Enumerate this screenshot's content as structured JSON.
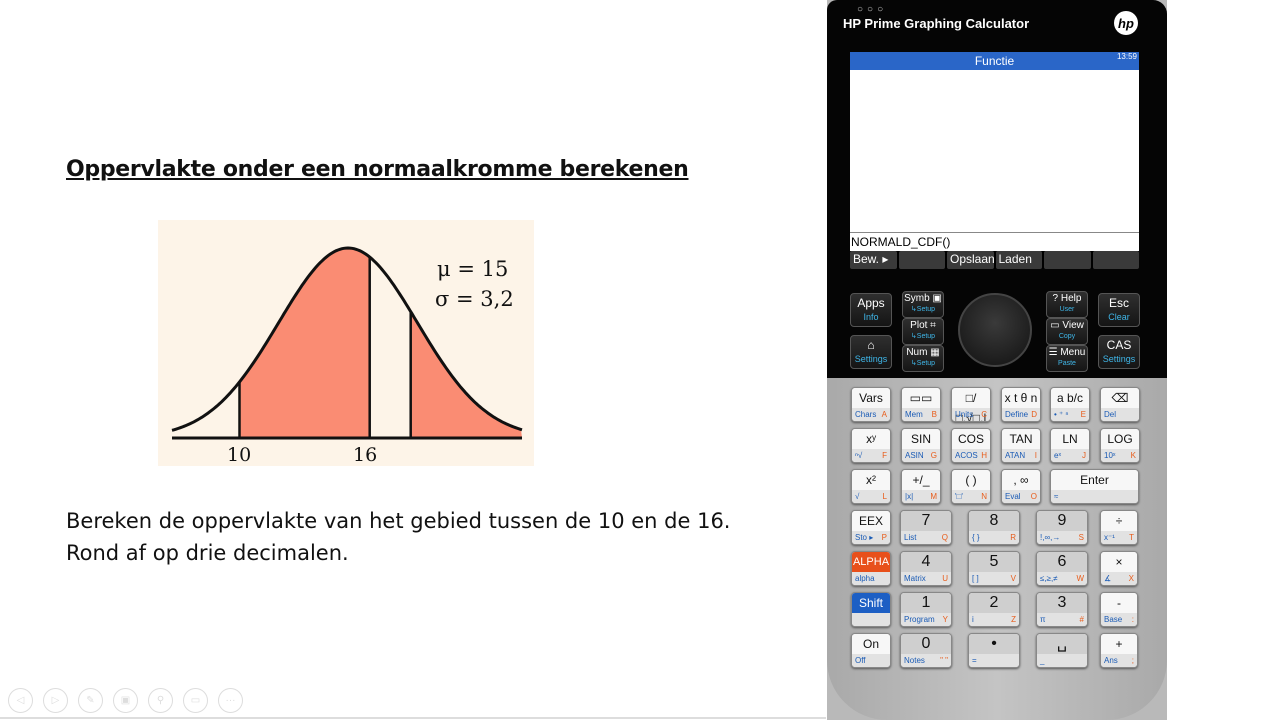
{
  "slide": {
    "title": "Oppervlakte onder een normaalkromme berekenen",
    "figure": {
      "mu_label": "μ = 15",
      "sigma_label": "σ = 3,2",
      "tick_labels": [
        "10",
        "16"
      ],
      "shade_color": "#fa8c73",
      "background": "#fdf4e8"
    },
    "question_line1": "Bereken de oppervlakte van het gebied tussen de 10 en de 16.",
    "question_line2": "Rond af op drie decimalen.",
    "toolbar_icons": [
      "back-icon",
      "forward-icon",
      "pen-icon",
      "pages-icon",
      "zoom-icon",
      "subtitles-icon",
      "more-icon"
    ]
  },
  "calculator": {
    "window_title": "HP Prime Graphing Calculator",
    "logo": "hp",
    "screen": {
      "app_title": "Functie",
      "clock": "13:59",
      "entry": "NORMALD_CDF()",
      "softkeys": [
        "Bew. ▸",
        "",
        "Opslaan",
        "Laden",
        "",
        ""
      ]
    },
    "top_keys": [
      {
        "main": "Apps",
        "shift": "Info"
      },
      {
        "main": "Symb ▣",
        "shift": "↳Setup"
      },
      {
        "main": "Plot ⌗",
        "shift": "↳Setup"
      },
      {
        "main": "Num ▦",
        "shift": "↳Setup"
      },
      {
        "main": "⌂",
        "shift": "Settings"
      },
      {
        "main": "? Help",
        "shift": "User"
      },
      {
        "main": "▭ View",
        "shift": "Copy"
      },
      {
        "main": "☰ Menu",
        "shift": "Paste"
      },
      {
        "main": "Esc",
        "shift": "Clear"
      },
      {
        "main": "CAS",
        "shift": "Settings"
      }
    ],
    "keys": [
      {
        "main": "Vars",
        "shift": "Chars",
        "alpha": "A"
      },
      {
        "main": "▭▭",
        "shift": "Mem",
        "alpha": "B"
      },
      {
        "main": "□/□,√□,|□|",
        "shift": "Units",
        "alpha": "C"
      },
      {
        "main": "x t θ n",
        "shift": "Define",
        "alpha": "D"
      },
      {
        "main": "a b/c",
        "shift": "• ⁺ ⁿ",
        "alpha": "E"
      },
      {
        "main": "⌫",
        "shift": "Del",
        "alpha": ""
      },
      {
        "main": "xʸ",
        "shift": "ⁿ√",
        "alpha": "F"
      },
      {
        "main": "SIN",
        "shift": "ASIN",
        "alpha": "G"
      },
      {
        "main": "COS",
        "shift": "ACOS",
        "alpha": "H"
      },
      {
        "main": "TAN",
        "shift": "ATAN",
        "alpha": "I"
      },
      {
        "main": "LN",
        "shift": "eˣ",
        "alpha": "J"
      },
      {
        "main": "LOG",
        "shift": "10ˣ",
        "alpha": "K"
      },
      {
        "main": "x²",
        "shift": "√",
        "alpha": "L"
      },
      {
        "main": "+/_",
        "shift": "|x|",
        "alpha": "M"
      },
      {
        "main": "( )",
        "shift": "'□'",
        "alpha": "N"
      },
      {
        "main": ", ∞",
        "shift": "Eval",
        "alpha": "O"
      },
      {
        "main": "Enter",
        "shift": "≈",
        "alpha": ""
      },
      {
        "main": "EEX",
        "shift": "Sto ▸",
        "alpha": "P"
      },
      {
        "main": "7",
        "shift": "List",
        "alpha": "Q"
      },
      {
        "main": "8",
        "shift": "{ }",
        "alpha": "R"
      },
      {
        "main": "9",
        "shift": "!,∞,→",
        "alpha": "S"
      },
      {
        "main": "÷",
        "shift": "x⁻¹",
        "alpha": "T"
      },
      {
        "main": "ALPHA",
        "shift": "alpha",
        "alpha": ""
      },
      {
        "main": "4",
        "shift": "Matrix",
        "alpha": "U"
      },
      {
        "main": "5",
        "shift": "[ ]",
        "alpha": "V"
      },
      {
        "main": "6",
        "shift": "≤,≥,≠",
        "alpha": "W"
      },
      {
        "main": "×",
        "shift": "∡",
        "alpha": "X"
      },
      {
        "main": "Shift",
        "shift": "",
        "alpha": ""
      },
      {
        "main": "1",
        "shift": "Program",
        "alpha": "Y"
      },
      {
        "main": "2",
        "shift": "i",
        "alpha": "Z"
      },
      {
        "main": "3",
        "shift": "π",
        "alpha": "#"
      },
      {
        "main": "-",
        "shift": "Base",
        "alpha": ":"
      },
      {
        "main": "On",
        "shift": "Off",
        "alpha": ""
      },
      {
        "main": "0",
        "shift": "Notes",
        "alpha": "\" \""
      },
      {
        "main": "•",
        "shift": "=",
        "alpha": ""
      },
      {
        "main": "␣",
        "shift": "_",
        "alpha": ""
      },
      {
        "main": "+",
        "shift": "Ans",
        "alpha": ";"
      }
    ]
  }
}
